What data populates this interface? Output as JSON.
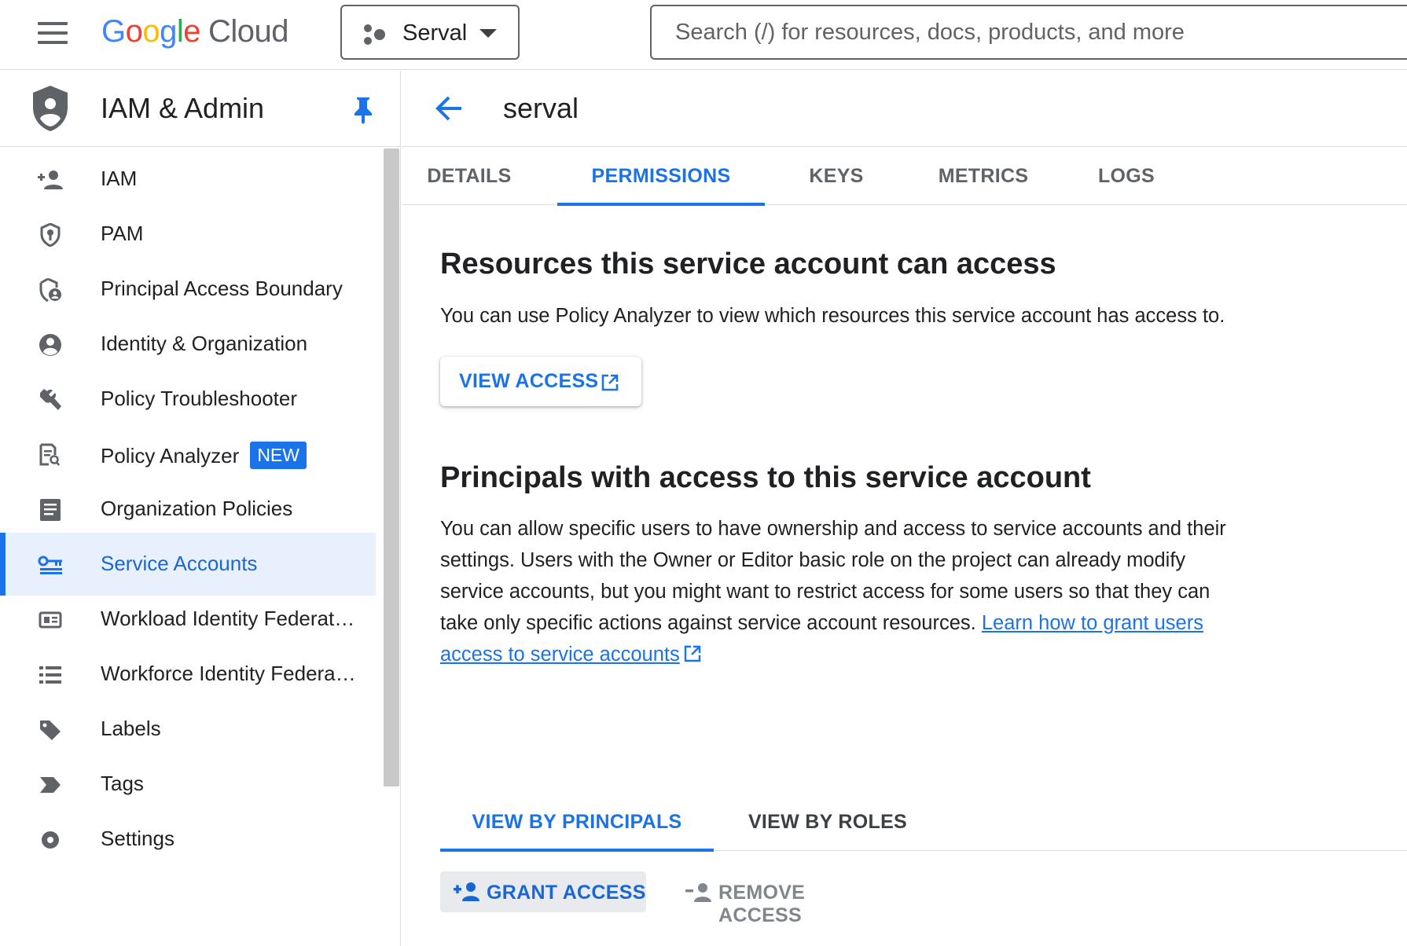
{
  "topbar": {
    "logo_google": [
      "G",
      "o",
      "o",
      "g",
      "l",
      "e"
    ],
    "logo_cloud": "Cloud",
    "project_name": "Serval",
    "search_placeholder": "Search (/) for resources, docs, products, and more"
  },
  "sidebar": {
    "title": "IAM & Admin",
    "items": [
      {
        "label": "IAM",
        "icon": "person-add-icon"
      },
      {
        "label": "PAM",
        "icon": "shield-key-icon"
      },
      {
        "label": "Principal Access Boundary",
        "icon": "shield-person-icon"
      },
      {
        "label": "Identity & Organization",
        "icon": "account-circle-icon"
      },
      {
        "label": "Policy Troubleshooter",
        "icon": "wrench-icon"
      },
      {
        "label": "Policy Analyzer",
        "icon": "document-search-icon",
        "badge": "NEW"
      },
      {
        "label": "Organization Policies",
        "icon": "article-icon"
      },
      {
        "label": "Service Accounts",
        "icon": "service-account-icon",
        "active": true
      },
      {
        "label": "Workload Identity Federat…",
        "icon": "id-card-icon"
      },
      {
        "label": "Workforce Identity Federa…",
        "icon": "list-icon"
      },
      {
        "label": "Labels",
        "icon": "tag-icon"
      },
      {
        "label": "Tags",
        "icon": "label-arrow-icon"
      },
      {
        "label": "Settings",
        "icon": "gear-icon"
      }
    ]
  },
  "header": {
    "title": "serval"
  },
  "tabs": [
    "DETAILS",
    "PERMISSIONS",
    "KEYS",
    "METRICS",
    "LOGS"
  ],
  "active_tab": "PERMISSIONS",
  "resources_section": {
    "heading": "Resources this service account can access",
    "description": "You can use Policy Analyzer to view which resources this service account has access to.",
    "button_label": "VIEW ACCESS"
  },
  "principals_section": {
    "heading": "Principals with access to this service account",
    "description": "You can allow specific users to have ownership and access to service accounts and their settings. Users with the Owner or Editor basic role on the project can already modify service accounts, but you might want to restrict access for some users so that they can take only specific actions against service account resources.",
    "link_text": "Learn how to grant users access to service accounts"
  },
  "view_tabs": [
    "VIEW BY PRINCIPALS",
    "VIEW BY ROLES"
  ],
  "actions": {
    "grant": "GRANT ACCESS",
    "remove": "REMOVE ACCESS"
  },
  "colors": {
    "accent": "#1a73e8",
    "active_bg": "#e8f0fe",
    "text": "#202124",
    "muted": "#5f6368"
  }
}
